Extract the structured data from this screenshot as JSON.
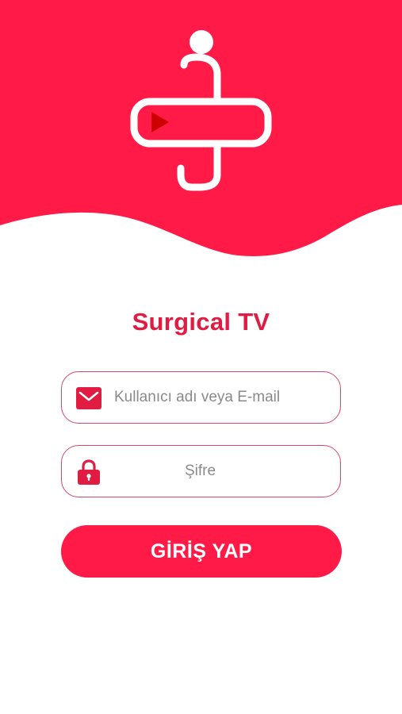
{
  "brand": {
    "title": "Surgical TV",
    "accent_color": "#ff1a47",
    "title_color": "#e11c43",
    "logo": "surgical-tv-logo",
    "logo_play_color": "#cc0000"
  },
  "login_form": {
    "username": {
      "icon": "envelope-icon",
      "value": "",
      "placeholder": "Kullanıcı adı veya E-mail"
    },
    "password": {
      "icon": "lock-icon",
      "value": "",
      "placeholder": "Şifre"
    },
    "submit_label": "GİRİŞ YAP"
  }
}
